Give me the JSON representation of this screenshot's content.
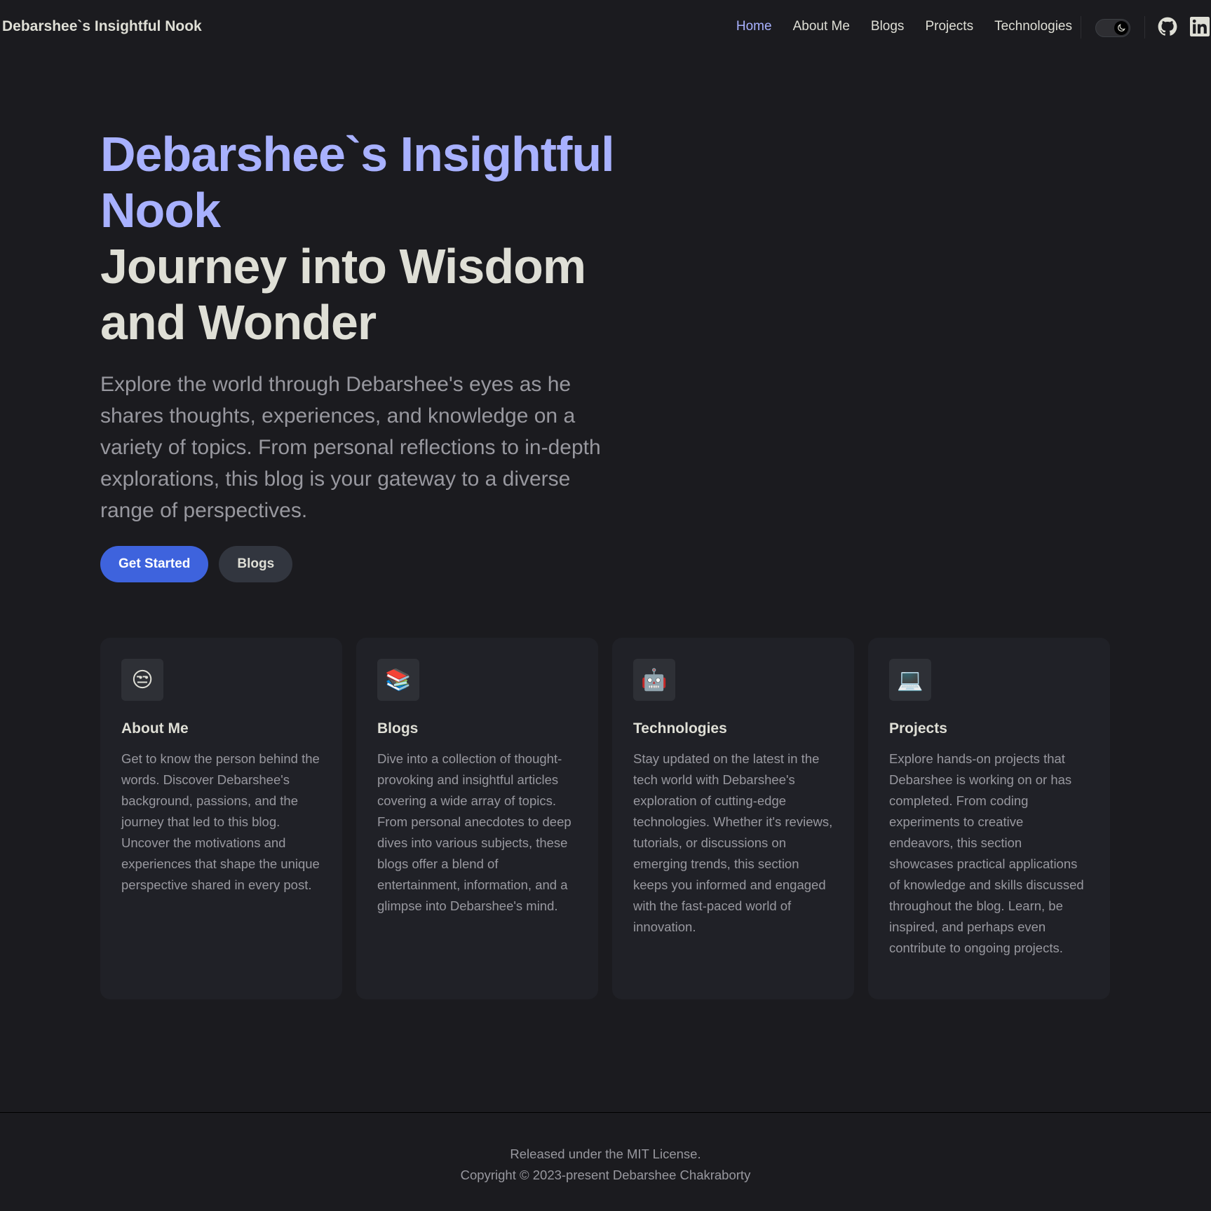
{
  "nav": {
    "brand": "Debarshee`s Insightful Nook",
    "links": [
      "Home",
      "About Me",
      "Blogs",
      "Projects",
      "Technologies"
    ],
    "active_link": "Home",
    "theme_toggle_icon": "moon-icon",
    "social_icons": [
      "github-icon",
      "linkedin-icon"
    ]
  },
  "hero": {
    "name": "Debarshee`s Insightful Nook",
    "tagline": "Journey into Wisdom and Wonder",
    "description": "Explore the world through Debarshee's eyes as he shares thoughts, experiences, and knowledge on a variety of topics. From personal reflections to in-depth explorations, this blog is your gateway to a diverse range of perspectives.",
    "primary_action": "Get Started",
    "secondary_action": "Blogs"
  },
  "features": [
    {
      "icon": "😒",
      "title": "About Me",
      "text": "Get to know the person behind the words. Discover Debarshee's background, passions, and the journey that led to this blog. Uncover the motivations and experiences that shape the unique perspective shared in every post."
    },
    {
      "icon": "📚",
      "title": "Blogs",
      "text": "Dive into a collection of thought-provoking and insightful articles covering a wide array of topics. From personal anecdotes to deep dives into various subjects, these blogs offer a blend of entertainment, information, and a glimpse into Debarshee's mind."
    },
    {
      "icon": "🤖",
      "title": "Technologies",
      "text": "Stay updated on the latest in the tech world with Debarshee's exploration of cutting-edge technologies. Whether it's reviews, tutorials, or discussions on emerging trends, this section keeps you informed and engaged with the fast-paced world of innovation."
    },
    {
      "icon": "💻",
      "title": "Projects",
      "text": "Explore hands-on projects that Debarshee is working on or has completed. From coding experiments to creative endeavors, this section showcases practical applications of knowledge and skills discussed throughout the blog. Learn, be inspired, and perhaps even contribute to ongoing projects."
    }
  ],
  "footer": {
    "message": "Released under the MIT License.",
    "copyright": "Copyright © 2023-present Debarshee Chakraborty"
  },
  "colors": {
    "background": "#1b1b1f",
    "brand": "#a8b1ff",
    "primary_button": "#3e63dd",
    "card": "#202127"
  }
}
